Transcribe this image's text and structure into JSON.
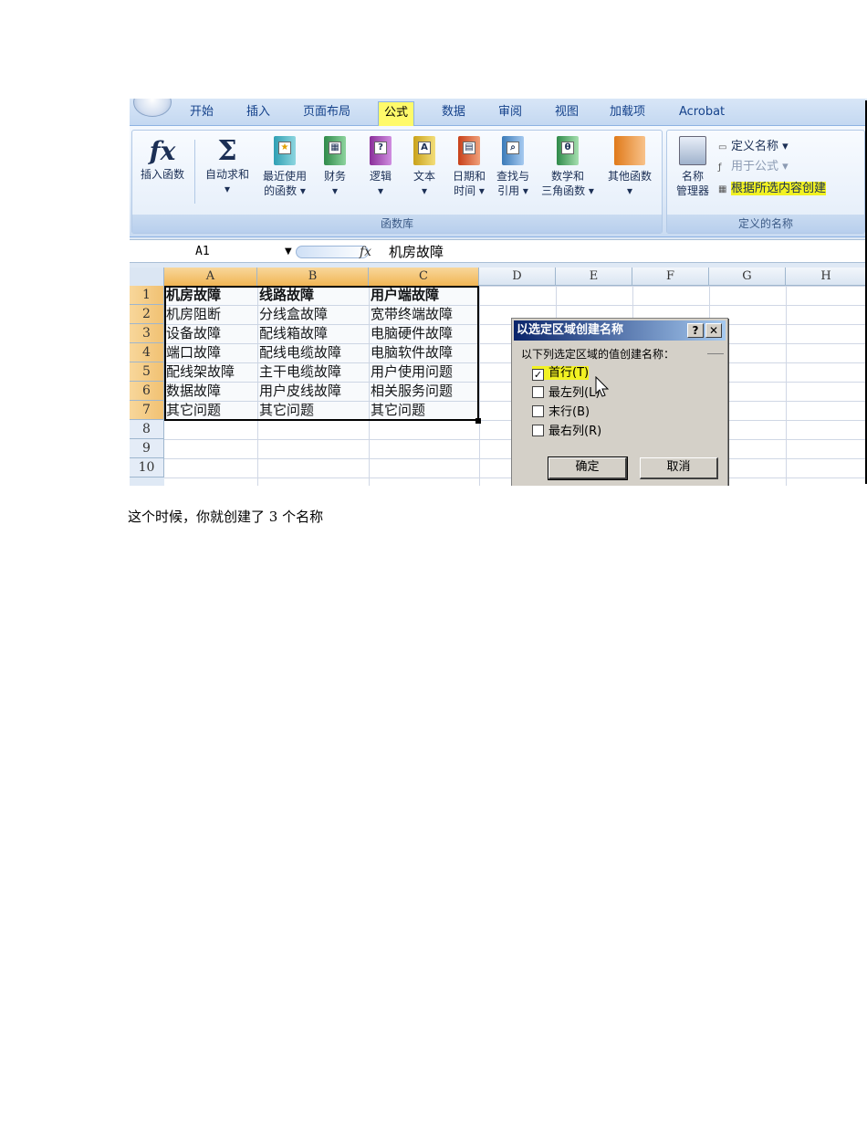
{
  "ribbon": {
    "tabs": [
      {
        "label": "开始",
        "active": false
      },
      {
        "label": "插入",
        "active": false
      },
      {
        "label": "页面布局",
        "active": false
      },
      {
        "label": "公式",
        "active": true
      },
      {
        "label": "数据",
        "active": false
      },
      {
        "label": "审阅",
        "active": false
      },
      {
        "label": "视图",
        "active": false
      },
      {
        "label": "加载项",
        "active": false
      },
      {
        "label": "Acrobat",
        "active": false
      }
    ],
    "function_library": {
      "group_label": "函数库",
      "insert_function": {
        "icon": "fx",
        "label": "插入函数"
      },
      "autosum": {
        "icon": "Σ",
        "label": "自动求和",
        "sub": "▾"
      },
      "recent": {
        "label": "最近使用",
        "sub": "的函数 ▾"
      },
      "finance": {
        "label": "财务",
        "sub": "▾"
      },
      "logic": {
        "label": "逻辑",
        "sub": "▾",
        "glyph": "?"
      },
      "text": {
        "label": "文本",
        "sub": "▾",
        "glyph": "A"
      },
      "datetime": {
        "label": "日期和",
        "sub": "时间 ▾"
      },
      "lookup": {
        "label": "查找与",
        "sub": "引用 ▾"
      },
      "math": {
        "label": "数学和",
        "sub": "三角函数 ▾",
        "glyph": "θ"
      },
      "other": {
        "label": "其他函数",
        "sub": "▾"
      }
    },
    "defined_names": {
      "group_label": "定义的名称",
      "name_manager": {
        "label": "名称",
        "sub": "管理器"
      },
      "define_name": "定义名称 ▾",
      "use_in_formula": "用于公式 ▾",
      "create_from_selection": "根据所选内容创建"
    }
  },
  "formula_bar": {
    "name_box": "A1",
    "fx": "fx",
    "value": "机房故障"
  },
  "grid": {
    "columns": [
      "A",
      "B",
      "C",
      "D",
      "E",
      "F",
      "G",
      "H"
    ],
    "rows": [
      "1",
      "2",
      "3",
      "4",
      "5",
      "6",
      "7",
      "8",
      "9",
      "10"
    ],
    "cells": [
      [
        "机房故障",
        "线路故障",
        "用户端故障"
      ],
      [
        "机房阻断",
        "分线盒故障",
        "宽带终端故障"
      ],
      [
        "设备故障",
        "配线箱故障",
        "电脑硬件故障"
      ],
      [
        "端口故障",
        "配线电缆故障",
        "电脑软件故障"
      ],
      [
        "配线架故障",
        "主干电缆故障",
        "用户使用问题"
      ],
      [
        "数据故障",
        "用户皮线故障",
        "相关服务问题"
      ],
      [
        "其它问题",
        "其它问题",
        "其它问题"
      ]
    ]
  },
  "dialog": {
    "title": "以选定区域创建名称",
    "help": "?",
    "close": "✕",
    "prompt": "以下列选定区域的值创建名称：",
    "options": [
      {
        "label": "首行(T)",
        "checked": true
      },
      {
        "label": "最左列(L)",
        "checked": false
      },
      {
        "label": "末行(B)",
        "checked": false
      },
      {
        "label": "最右列(R)",
        "checked": false
      }
    ],
    "ok": "确定",
    "cancel": "取消"
  },
  "document": {
    "caption": "这个时候，你就创建了 3 个名称"
  },
  "colors": {
    "highlight": "#f2f222",
    "selection_header": "#f1b554",
    "dialog_title": "#0a246a"
  }
}
